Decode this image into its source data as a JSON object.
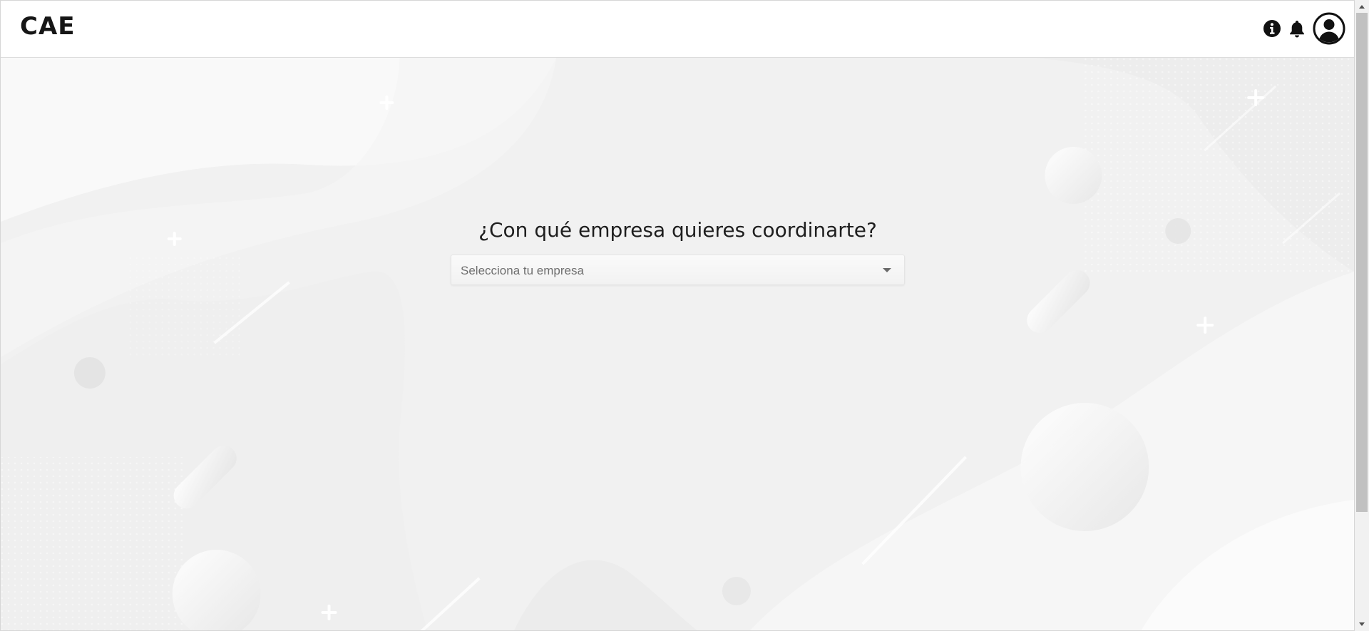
{
  "header": {
    "logo": "CAE",
    "icons": [
      "info-icon",
      "bell-icon",
      "user-account-icon"
    ]
  },
  "main": {
    "question": "¿Con qué empresa quieres coordinarte?",
    "company_select": {
      "placeholder": "Selecciona tu empresa"
    }
  },
  "colors": {
    "background": "#f1f1f1",
    "header_bg": "#ffffff",
    "text_dark": "#1e1e1e",
    "placeholder": "#6f6f6f"
  }
}
